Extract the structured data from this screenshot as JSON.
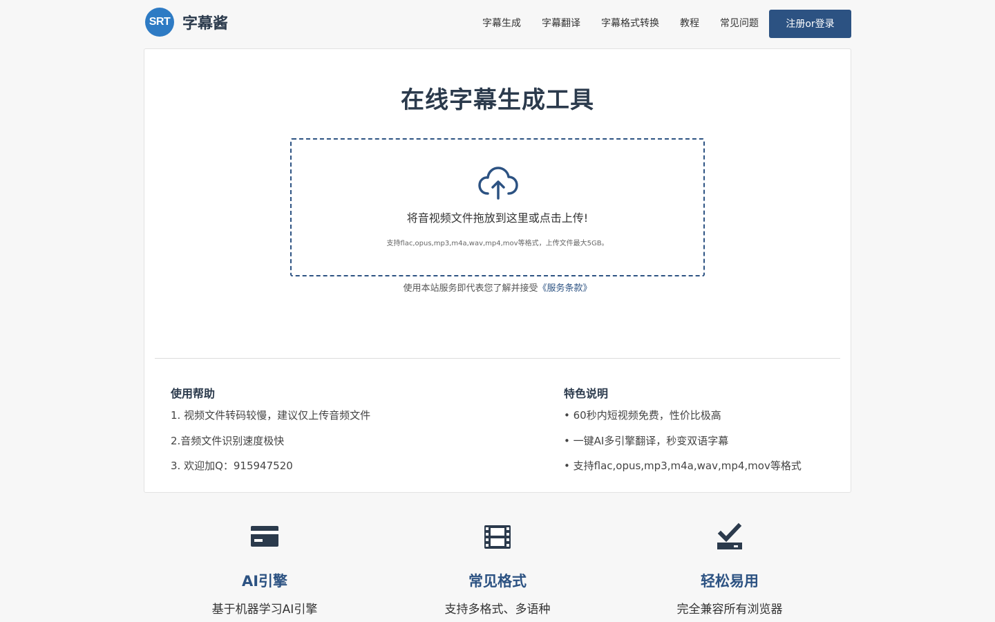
{
  "header": {
    "logo_badge": "SRT",
    "logo_text": "字幕酱",
    "nav": [
      "字幕生成",
      "字幕翻译",
      "字幕格式转换",
      "教程",
      "常见问题"
    ],
    "login_label": "注册or登录"
  },
  "main": {
    "title": "在线字幕生成工具",
    "drop_text": "将音视频文件拖放到这里或点击上传!",
    "drop_hint": "支持flac,opus,mp3,m4a,wav,mp4,mov等格式，上传文件最大5GB。",
    "terms_text": "使用本站服务即代表您了解并接受",
    "terms_link": "《服务条款》"
  },
  "help": {
    "title": "使用帮助",
    "items": [
      "1. 视频文件转码较慢，建议仅上传音频文件",
      "2.音频文件识别速度极快",
      "3. 欢迎加Q：915947520"
    ]
  },
  "specs": {
    "title": "特色说明",
    "items": [
      "• 60秒内短视频免费，性价比极高",
      "• 一键AI多引擎翻译，秒变双语字幕",
      "• 支持flac,opus,mp3,m4a,wav,mp4,mov等格式"
    ]
  },
  "features": [
    {
      "icon": "credit-card-icon",
      "title": "AI引擎",
      "desc": "基于机器学习AI引擎"
    },
    {
      "icon": "film-icon",
      "title": "常见格式",
      "desc": "支持多格式、多语种"
    },
    {
      "icon": "check-tray-icon",
      "title": "轻松易用",
      "desc": "完全兼容所有浏览器"
    }
  ],
  "colors": {
    "accent": "#2c5282",
    "logo_blue": "#2e7bc4",
    "heading": "#2b3a4c",
    "background": "#f7f7f7"
  }
}
